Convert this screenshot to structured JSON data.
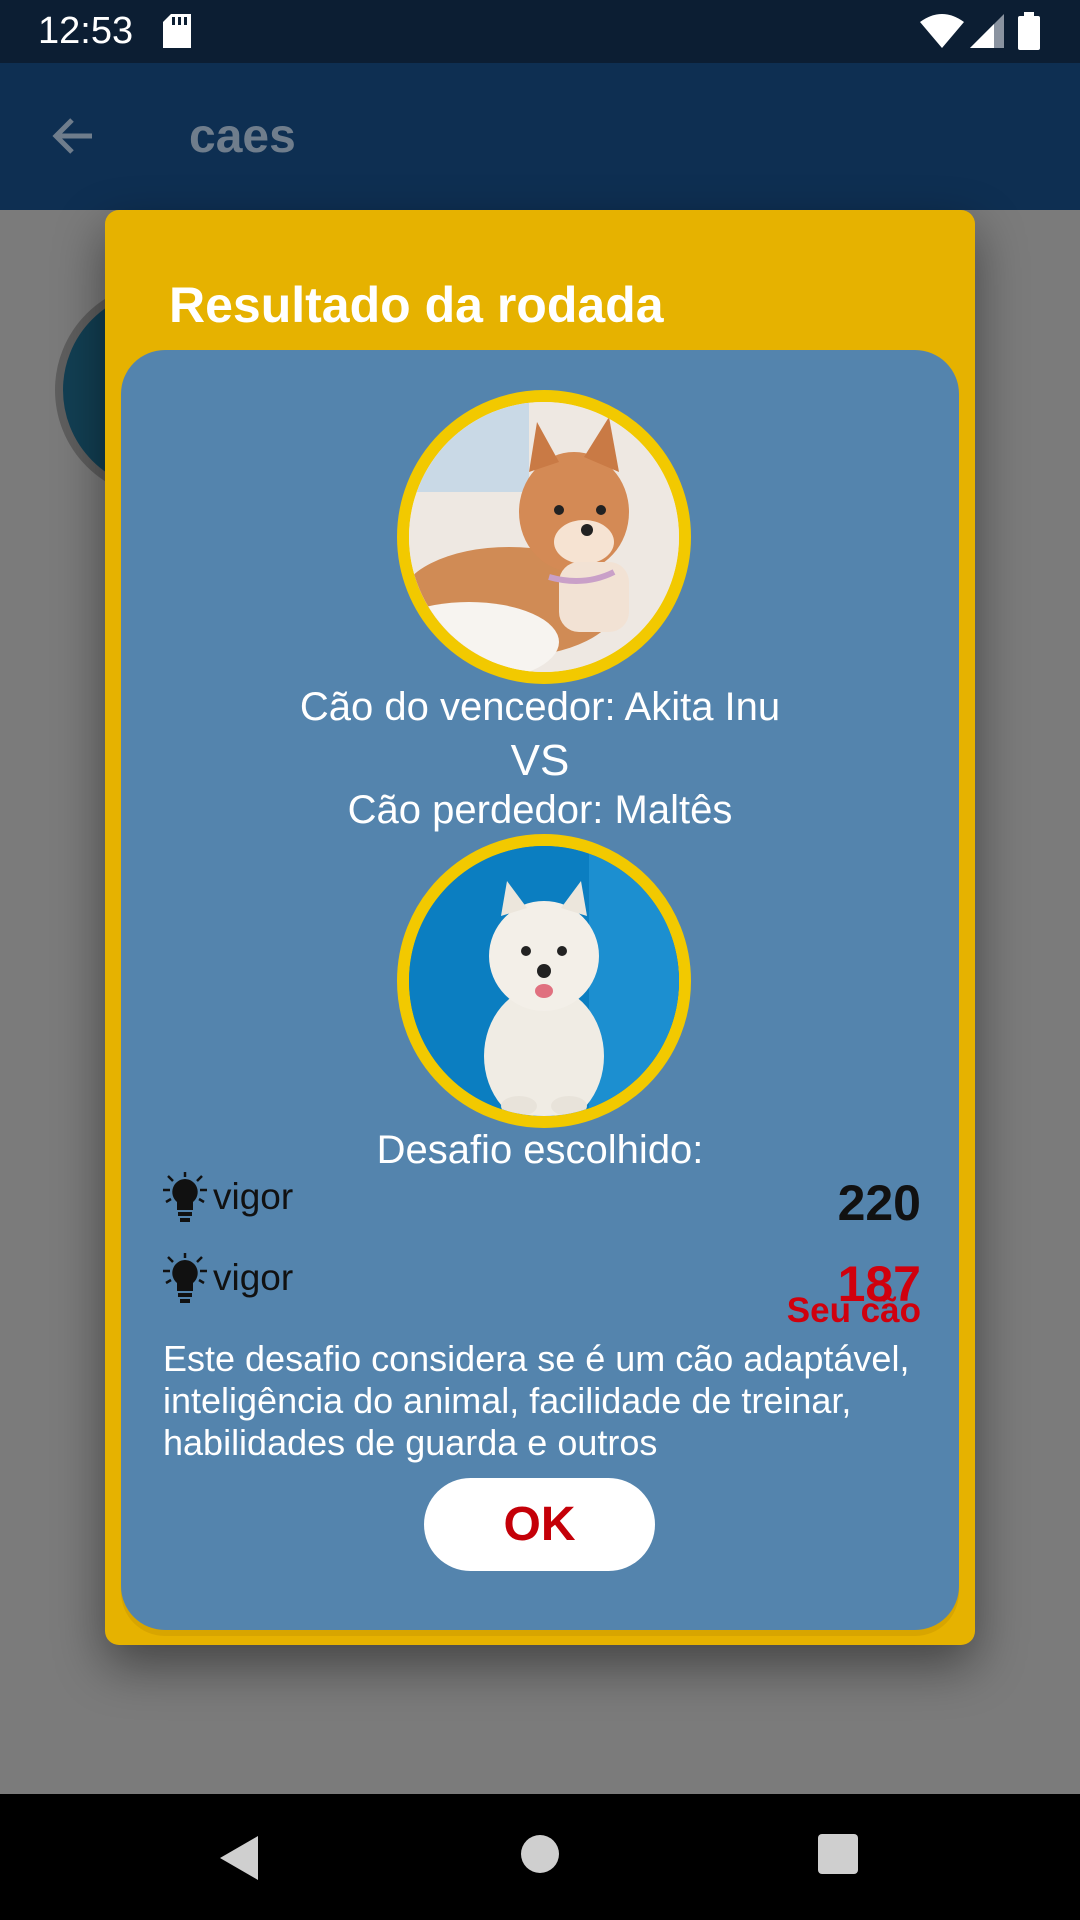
{
  "status_bar": {
    "time": "12:53",
    "icons": [
      "sd-card-icon",
      "wifi-icon",
      "signal-icon",
      "battery-icon"
    ]
  },
  "app_bar": {
    "title": "caes",
    "back_icon": "arrow-left-icon"
  },
  "dialog": {
    "title": "Resultado da rodada",
    "winner_text": "Cão do vencedor: Akita Inu",
    "vs_text": "VS",
    "loser_text": "Cão perdedor: Maltês",
    "challenge_label": "Desafio escolhido:",
    "attributes": [
      {
        "icon": "lightbulb-icon",
        "label": "vigor",
        "value": "220"
      },
      {
        "icon": "lightbulb-icon",
        "label": "vigor",
        "value": "187"
      }
    ],
    "your_dog_label": "Seu cão",
    "description": "Este desafio considera se é um cão adaptável, inteligência do animal, facilidade de treinar, habilidades de guarda e outros",
    "ok_button": "OK"
  },
  "nav_bar": {
    "icons": [
      "nav-back-icon",
      "nav-home-icon",
      "nav-recents-icon"
    ]
  },
  "colors": {
    "dialog_frame": "#e6b200",
    "dialog_body": "#5484ad",
    "photo_border": "#f2c900",
    "highlight_red": "#d0000d"
  }
}
